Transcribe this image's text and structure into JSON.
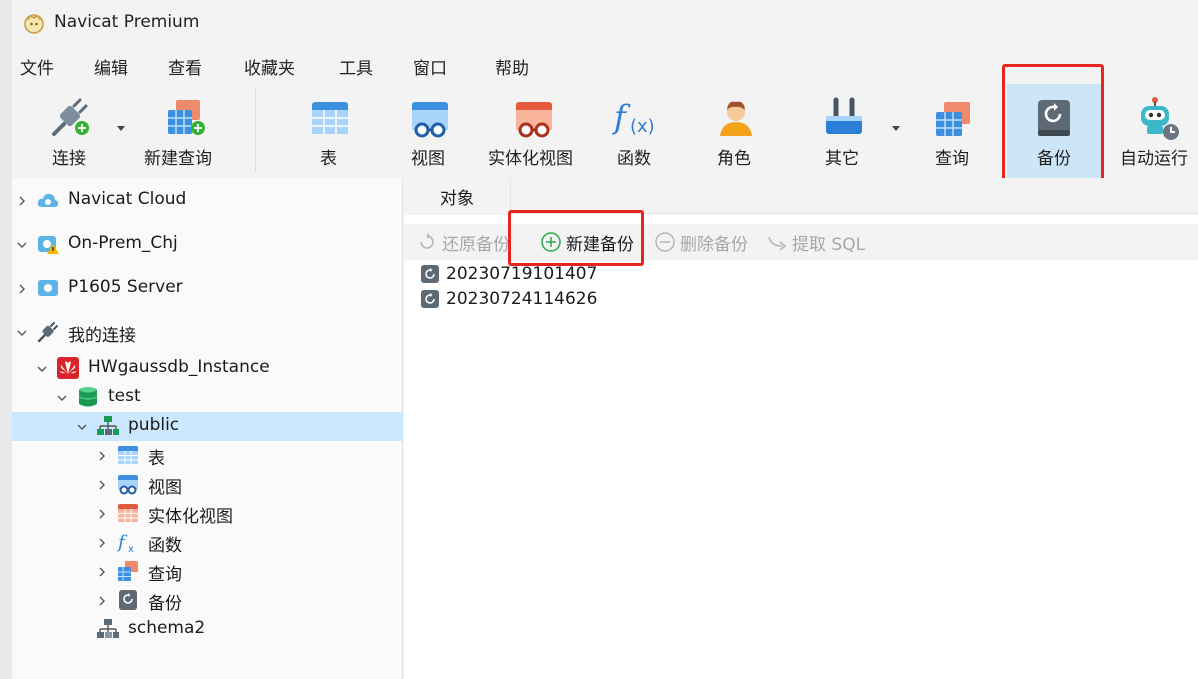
{
  "app": {
    "title": "Navicat Premium"
  },
  "menu": {
    "items": [
      "文件",
      "编辑",
      "查看",
      "收藏夹",
      "工具",
      "窗口",
      "帮助"
    ]
  },
  "toolbar": {
    "items": [
      "连接",
      "新建查询",
      "表",
      "视图",
      "实体化视图",
      "函数",
      "角色",
      "其它",
      "查询",
      "备份",
      "自动运行"
    ],
    "active": "备份"
  },
  "sidebar": {
    "nodes": [
      {
        "label": "Navicat Cloud",
        "icon": "cloud-icon",
        "expanded": false
      },
      {
        "label": "On-Prem_Chj",
        "icon": "onprem-warning-icon",
        "expanded": true
      },
      {
        "label": "P1605 Server",
        "icon": "server-icon",
        "expanded": false
      },
      {
        "label": "我的连接",
        "icon": "connection-plug-icon",
        "expanded": true
      },
      {
        "label": "HWgaussdb_Instance",
        "icon": "huawei-icon",
        "expanded": true
      },
      {
        "label": "test",
        "icon": "database-icon",
        "expanded": true
      },
      {
        "label": "public",
        "icon": "schema-icon",
        "expanded": true,
        "selected": true
      },
      {
        "label": "表",
        "icon": "table-icon",
        "expanded": false
      },
      {
        "label": "视图",
        "icon": "view-icon",
        "expanded": false
      },
      {
        "label": "实体化视图",
        "icon": "materialized-view-icon",
        "expanded": false
      },
      {
        "label": "函数",
        "icon": "function-icon",
        "expanded": false
      },
      {
        "label": "查询",
        "icon": "query-icon",
        "expanded": false
      },
      {
        "label": "备份",
        "icon": "backup-icon",
        "expanded": false
      },
      {
        "label": "schema2",
        "icon": "schema-icon",
        "expanded": false
      }
    ]
  },
  "main": {
    "tab_label": "对象",
    "subtoolbar": {
      "restore": "还原备份",
      "new": "新建备份",
      "delete": "删除备份",
      "extract": "提取 SQL"
    },
    "backups": [
      "20230719101407",
      "20230724114626"
    ]
  },
  "colors": {
    "highlight_red": "#e8251f",
    "selection_blue": "#cce8ff",
    "active_tool": "#cde6f7"
  }
}
